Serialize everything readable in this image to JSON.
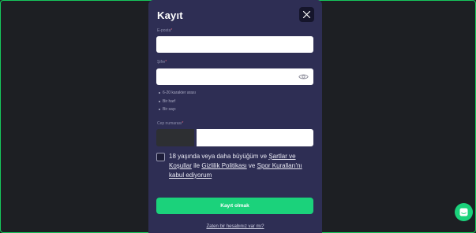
{
  "modal": {
    "title": "Kayıt",
    "close_icon": "close-icon"
  },
  "email": {
    "label": "E-posta",
    "required_mark": "*",
    "value": "",
    "placeholder": ""
  },
  "password": {
    "label": "Şifre",
    "required_mark": "*",
    "value": "",
    "placeholder": "",
    "toggle_icon": "eye-icon",
    "rules": [
      "6-20 karakter arası",
      "Bir harf",
      "Bir sayı"
    ]
  },
  "phone": {
    "label": "Cep numarası",
    "required_mark": "*",
    "prefix": "",
    "value": ""
  },
  "consent": {
    "prefix": "18 yaşında veya daha büyüğüm ve ",
    "terms_link": "Şartlar ve Koşullar",
    "between_1": " ile ",
    "privacy_link": "Gizlilik Politikası",
    "between_2": " ve ",
    "sports_link": "Spor Kuralları'nı",
    "suffix_link": "kabul ediyorum",
    "checked": false
  },
  "submit_label": "Kayıt olmak",
  "login_link": "Zaten bir hesabınız var mı?",
  "chat_icon": "chat-icon",
  "colors": {
    "background": "#1d1f23",
    "modal": "#2e2e54",
    "accent": "#1bd27b",
    "required": "#e2667c"
  }
}
